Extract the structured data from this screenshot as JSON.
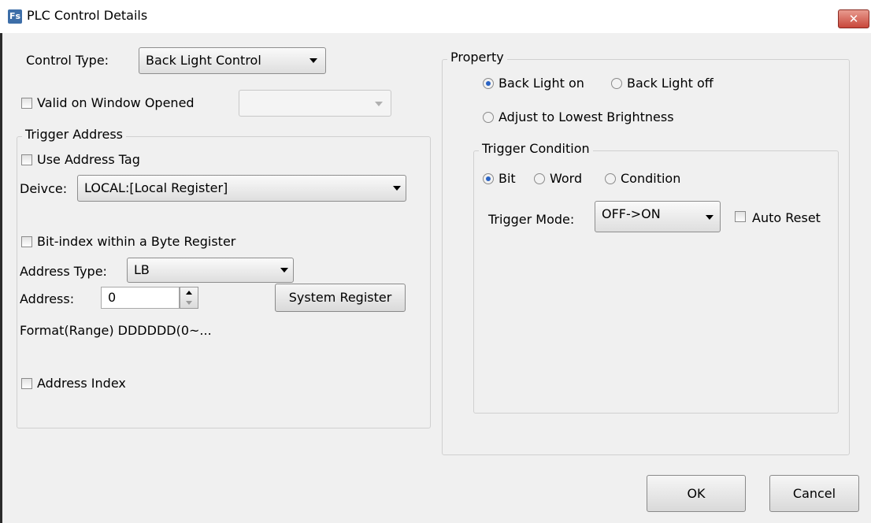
{
  "window": {
    "title": "PLC Control Details",
    "app_icon_text": "Fs",
    "close_symbol": "✕"
  },
  "control_type": {
    "label": "Control Type:",
    "value": "Back Light Control"
  },
  "valid_on_window_opened": {
    "label": "Valid on Window Opened",
    "checked": false,
    "value": ""
  },
  "trigger_address": {
    "legend": "Trigger Address",
    "use_address_tag": {
      "label": "Use Address Tag",
      "checked": false
    },
    "device": {
      "label": "Deivce:",
      "value": "LOCAL:[Local Register]"
    },
    "bit_index": {
      "label": "Bit-index within a Byte Register",
      "checked": false
    },
    "address_type": {
      "label": "Address Type:",
      "value": "LB"
    },
    "address": {
      "label": "Address:",
      "value": "0"
    },
    "system_register_button": "System Register",
    "format": "Format(Range) DDDDDD(0~...",
    "address_index": {
      "label": "Address Index",
      "checked": false
    }
  },
  "property": {
    "legend": "Property",
    "back_light_on": {
      "label": "Back Light on",
      "selected": true
    },
    "back_light_off": {
      "label": "Back Light off",
      "selected": false
    },
    "adjust_lowest": {
      "label": "Adjust to Lowest Brightness",
      "selected": false
    },
    "trigger_condition": {
      "legend": "Trigger Condition",
      "bit": {
        "label": "Bit",
        "selected": true
      },
      "word": {
        "label": "Word",
        "selected": false
      },
      "condition": {
        "label": "Condition",
        "selected": false
      },
      "trigger_mode": {
        "label": "Trigger Mode:",
        "value": "OFF->ON"
      },
      "auto_reset": {
        "label": "Auto Reset",
        "checked": false
      }
    }
  },
  "buttons": {
    "ok": "OK",
    "cancel": "Cancel"
  },
  "colors": {
    "dialog_bg": "#f0f0f0",
    "radio_selected": "#2a63c4",
    "close_button": "#c8463a"
  }
}
